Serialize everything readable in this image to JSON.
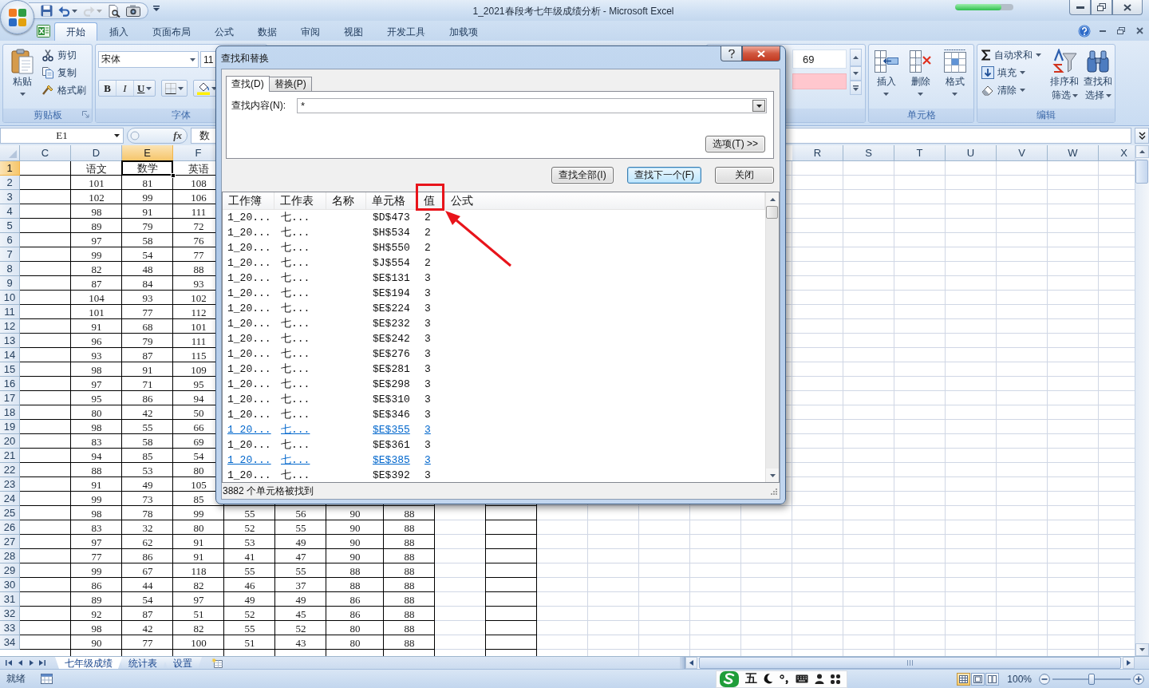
{
  "title_bar": {
    "title": "1_2021春段考七年级成绩分析 - Microsoft Excel",
    "quick_access": [
      {
        "kind": "save",
        "disabled": false
      },
      {
        "kind": "undo",
        "disabled": false
      },
      {
        "kind": "redo",
        "disabled": true
      },
      {
        "kind": "print_preview",
        "disabled": false
      },
      {
        "kind": "camera",
        "disabled": false
      }
    ],
    "progress": {
      "level": 0.8
    }
  },
  "ribbon_tabs": [
    {
      "label": "开始",
      "selected": true
    },
    {
      "label": "插入",
      "selected": false
    },
    {
      "label": "页面布局",
      "selected": false
    },
    {
      "label": "公式",
      "selected": false
    },
    {
      "label": "数据",
      "selected": false
    },
    {
      "label": "审阅",
      "selected": false
    },
    {
      "label": "视图",
      "selected": false
    },
    {
      "label": "开发工具",
      "selected": false
    },
    {
      "label": "加载项",
      "selected": false
    }
  ],
  "ribbon": {
    "clipboard": {
      "label": "剪贴板",
      "paste": "粘贴",
      "cut": "剪切",
      "copy": "复制",
      "format_painter": "格式刷"
    },
    "font": {
      "label": "字体",
      "font_name": "宋体",
      "font_size": "11",
      "bold": "B",
      "italic": "I",
      "underline": "U"
    },
    "styles": {
      "preview": "69"
    },
    "cells": {
      "label": "单元格",
      "insert": "插入",
      "delete": "删除",
      "format": "格式"
    },
    "editing": {
      "label": "编辑",
      "autosum": "自动求和",
      "fill": "填充",
      "clear": "清除",
      "sort_filter": [
        "排序和",
        "筛选"
      ],
      "find_select": [
        "查找和",
        "选择"
      ]
    }
  },
  "formula_bar": {
    "name_box": "E1",
    "function_button": "fx",
    "content": "数"
  },
  "sheet": {
    "columns": [
      {
        "label": "C",
        "selected": false
      },
      {
        "label": "D",
        "selected": false
      },
      {
        "label": "E",
        "selected": true
      },
      {
        "label": "F",
        "selected": false
      },
      null,
      null,
      null,
      null,
      null,
      null,
      null,
      null,
      null,
      null,
      null,
      {
        "label": "R",
        "selected": false
      },
      {
        "label": "S",
        "selected": false
      },
      {
        "label": "T",
        "selected": false
      },
      {
        "label": "U",
        "selected": false
      },
      {
        "label": "V",
        "selected": false
      },
      {
        "label": "W",
        "selected": false
      },
      {
        "label": "X",
        "selected": false
      }
    ],
    "rows": [
      {
        "number": "1",
        "selected": true,
        "cells": [
          null,
          "语文",
          "数学",
          "英语"
        ]
      },
      {
        "number": "2",
        "selected": false,
        "cells": [
          null,
          "101",
          "81",
          "108"
        ]
      },
      {
        "number": "3",
        "selected": false,
        "cells": [
          null,
          "102",
          "99",
          "106"
        ]
      },
      {
        "number": "4",
        "selected": false,
        "cells": [
          null,
          "98",
          "91",
          "111"
        ]
      },
      {
        "number": "5",
        "selected": false,
        "cells": [
          null,
          "89",
          "79",
          "72"
        ]
      },
      {
        "number": "6",
        "selected": false,
        "cells": [
          null,
          "97",
          "58",
          "76"
        ]
      },
      {
        "number": "7",
        "selected": false,
        "cells": [
          null,
          "99",
          "54",
          "77"
        ]
      },
      {
        "number": "8",
        "selected": false,
        "cells": [
          null,
          "82",
          "48",
          "88"
        ]
      },
      {
        "number": "9",
        "selected": false,
        "cells": [
          null,
          "87",
          "84",
          "93"
        ]
      },
      {
        "number": "10",
        "selected": false,
        "cells": [
          null,
          "104",
          "93",
          "102"
        ]
      },
      {
        "number": "11",
        "selected": false,
        "cells": [
          null,
          "101",
          "77",
          "112"
        ]
      },
      {
        "number": "12",
        "selected": false,
        "cells": [
          null,
          "91",
          "68",
          "101"
        ]
      },
      {
        "number": "13",
        "selected": false,
        "cells": [
          null,
          "96",
          "79",
          "111"
        ]
      },
      {
        "number": "14",
        "selected": false,
        "cells": [
          null,
          "93",
          "87",
          "115"
        ]
      },
      {
        "number": "15",
        "selected": false,
        "cells": [
          null,
          "98",
          "91",
          "109"
        ]
      },
      {
        "number": "16",
        "selected": false,
        "cells": [
          null,
          "97",
          "71",
          "95"
        ]
      },
      {
        "number": "17",
        "selected": false,
        "cells": [
          null,
          "95",
          "86",
          "94"
        ]
      },
      {
        "number": "18",
        "selected": false,
        "cells": [
          null,
          "80",
          "42",
          "50"
        ]
      },
      {
        "number": "19",
        "selected": false,
        "cells": [
          null,
          "98",
          "55",
          "66"
        ]
      },
      {
        "number": "20",
        "selected": false,
        "cells": [
          null,
          "83",
          "58",
          "69"
        ]
      },
      {
        "number": "21",
        "selected": false,
        "cells": [
          null,
          "94",
          "85",
          "54"
        ]
      },
      {
        "number": "22",
        "selected": false,
        "cells": [
          null,
          "88",
          "53",
          "80"
        ]
      },
      {
        "number": "23",
        "selected": false,
        "cells": [
          null,
          "91",
          "49",
          "105"
        ]
      },
      {
        "number": "24",
        "selected": false,
        "cells": [
          null,
          "99",
          "73",
          "85"
        ]
      },
      {
        "number": "25",
        "selected": false,
        "cells": [
          null,
          "98",
          "78",
          "99",
          "55",
          "56",
          "90",
          "88"
        ]
      },
      {
        "number": "26",
        "selected": false,
        "cells": [
          null,
          "83",
          "32",
          "80",
          "52",
          "55",
          "90",
          "88"
        ]
      },
      {
        "number": "27",
        "selected": false,
        "cells": [
          null,
          "97",
          "62",
          "91",
          "53",
          "49",
          "90",
          "88"
        ]
      },
      {
        "number": "28",
        "selected": false,
        "cells": [
          null,
          "77",
          "86",
          "91",
          "41",
          "47",
          "90",
          "88"
        ]
      },
      {
        "number": "29",
        "selected": false,
        "cells": [
          null,
          "99",
          "67",
          "118",
          "55",
          "55",
          "88",
          "88"
        ]
      },
      {
        "number": "30",
        "selected": false,
        "cells": [
          null,
          "86",
          "44",
          "82",
          "46",
          "37",
          "88",
          "88"
        ]
      },
      {
        "number": "31",
        "selected": false,
        "cells": [
          null,
          "89",
          "54",
          "97",
          "49",
          "49",
          "86",
          "88"
        ]
      },
      {
        "number": "32",
        "selected": false,
        "cells": [
          null,
          "92",
          "87",
          "51",
          "52",
          "45",
          "86",
          "88"
        ]
      },
      {
        "number": "33",
        "selected": false,
        "cells": [
          null,
          "98",
          "42",
          "82",
          "55",
          "52",
          "80",
          "88"
        ]
      },
      {
        "number": "34",
        "selected": false,
        "cells": [
          null,
          "90",
          "77",
          "100",
          "51",
          "43",
          "80",
          "88"
        ]
      }
    ]
  },
  "sheet_tabs": [
    {
      "label": "七年级成绩",
      "selected": true
    },
    {
      "label": "统计表",
      "selected": false
    },
    {
      "label": "设置",
      "selected": false
    }
  ],
  "find_dialog": {
    "title": "查找和替换",
    "tabs": [
      {
        "label": "查找(D)",
        "selected": true
      },
      {
        "label": "替换(P)",
        "selected": false
      }
    ],
    "find_label": "查找内容(N):",
    "find_value": "*",
    "options_button": "选项(T) >>",
    "buttons": [
      {
        "label": "查找全部(I)",
        "default": false
      },
      {
        "label": "查找下一个(F)",
        "default": true
      },
      {
        "label": "关闭",
        "default": false
      }
    ],
    "results": {
      "columns": [
        {
          "label": "工作簿",
          "circled": false
        },
        {
          "label": "工作表",
          "circled": false
        },
        {
          "label": "名称",
          "circled": false
        },
        {
          "label": "单元格",
          "circled": false
        },
        {
          "label": "值",
          "circled": true
        },
        {
          "label": "公式",
          "circled": false
        }
      ],
      "rows": [
        {
          "workbook": "1_20...",
          "sheet": "七...",
          "cell": "$D$473",
          "value": "2",
          "linked": false
        },
        {
          "workbook": "1_20...",
          "sheet": "七...",
          "cell": "$H$534",
          "value": "2",
          "linked": false
        },
        {
          "workbook": "1_20...",
          "sheet": "七...",
          "cell": "$H$550",
          "value": "2",
          "linked": false
        },
        {
          "workbook": "1_20...",
          "sheet": "七...",
          "cell": "$J$554",
          "value": "2",
          "linked": false
        },
        {
          "workbook": "1_20...",
          "sheet": "七...",
          "cell": "$E$131",
          "value": "3",
          "linked": false
        },
        {
          "workbook": "1_20...",
          "sheet": "七...",
          "cell": "$E$194",
          "value": "3",
          "linked": false
        },
        {
          "workbook": "1_20...",
          "sheet": "七...",
          "cell": "$E$224",
          "value": "3",
          "linked": false
        },
        {
          "workbook": "1_20...",
          "sheet": "七...",
          "cell": "$E$232",
          "value": "3",
          "linked": false
        },
        {
          "workbook": "1_20...",
          "sheet": "七...",
          "cell": "$E$242",
          "value": "3",
          "linked": false
        },
        {
          "workbook": "1_20...",
          "sheet": "七...",
          "cell": "$E$276",
          "value": "3",
          "linked": false
        },
        {
          "workbook": "1_20...",
          "sheet": "七...",
          "cell": "$E$281",
          "value": "3",
          "linked": false
        },
        {
          "workbook": "1_20...",
          "sheet": "七...",
          "cell": "$E$298",
          "value": "3",
          "linked": false
        },
        {
          "workbook": "1_20...",
          "sheet": "七...",
          "cell": "$E$310",
          "value": "3",
          "linked": false
        },
        {
          "workbook": "1_20...",
          "sheet": "七...",
          "cell": "$E$346",
          "value": "3",
          "linked": false
        },
        {
          "workbook": "1_20...",
          "sheet": "七...",
          "cell": "$E$355",
          "value": "3",
          "linked": true
        },
        {
          "workbook": "1_20...",
          "sheet": "七...",
          "cell": "$E$361",
          "value": "3",
          "linked": false
        },
        {
          "workbook": "1_20...",
          "sheet": "七...",
          "cell": "$E$385",
          "value": "3",
          "linked": true
        },
        {
          "workbook": "1_20...",
          "sheet": "七...",
          "cell": "$E$392",
          "value": "3",
          "linked": false
        }
      ]
    },
    "status": "3882 个单元格被找到"
  },
  "status_bar": {
    "status": "就绪",
    "ime_mode": "五",
    "views": [
      {
        "kind": "normal",
        "selected": true
      },
      {
        "kind": "page_layout",
        "selected": false
      },
      {
        "kind": "page_break",
        "selected": false
      }
    ],
    "zoom": "100%",
    "zoom_slider": {
      "level": 0.5
    }
  }
}
